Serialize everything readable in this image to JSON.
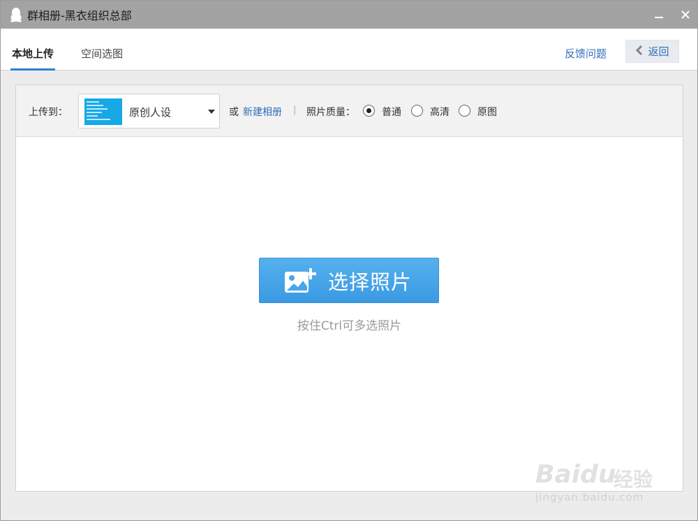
{
  "window": {
    "title": "群相册-黑衣组织总部"
  },
  "tabs": {
    "local_upload": "本地上传",
    "space_select": "空间选图"
  },
  "header": {
    "feedback": "反馈问题",
    "back": "返回"
  },
  "toolbar": {
    "upload_to_label": "上传到：",
    "album_selected": "原创人设",
    "or": "或",
    "new_album": "新建相册",
    "separator": "|",
    "quality_label": "照片质量：",
    "quality_options": [
      "普通",
      "高清",
      "原图"
    ],
    "quality_selected": "普通"
  },
  "main": {
    "select_photo_button": "选择照片",
    "hint": "按住Ctrl可多选照片"
  },
  "watermark": {
    "brand": "Baidu",
    "brand_cn": "经验",
    "url": "jingyan.baidu.com"
  },
  "colors": {
    "accent_blue": "#3b9ae2",
    "link_blue": "#2f6fb8",
    "titlebar": "#a3a3a3"
  }
}
